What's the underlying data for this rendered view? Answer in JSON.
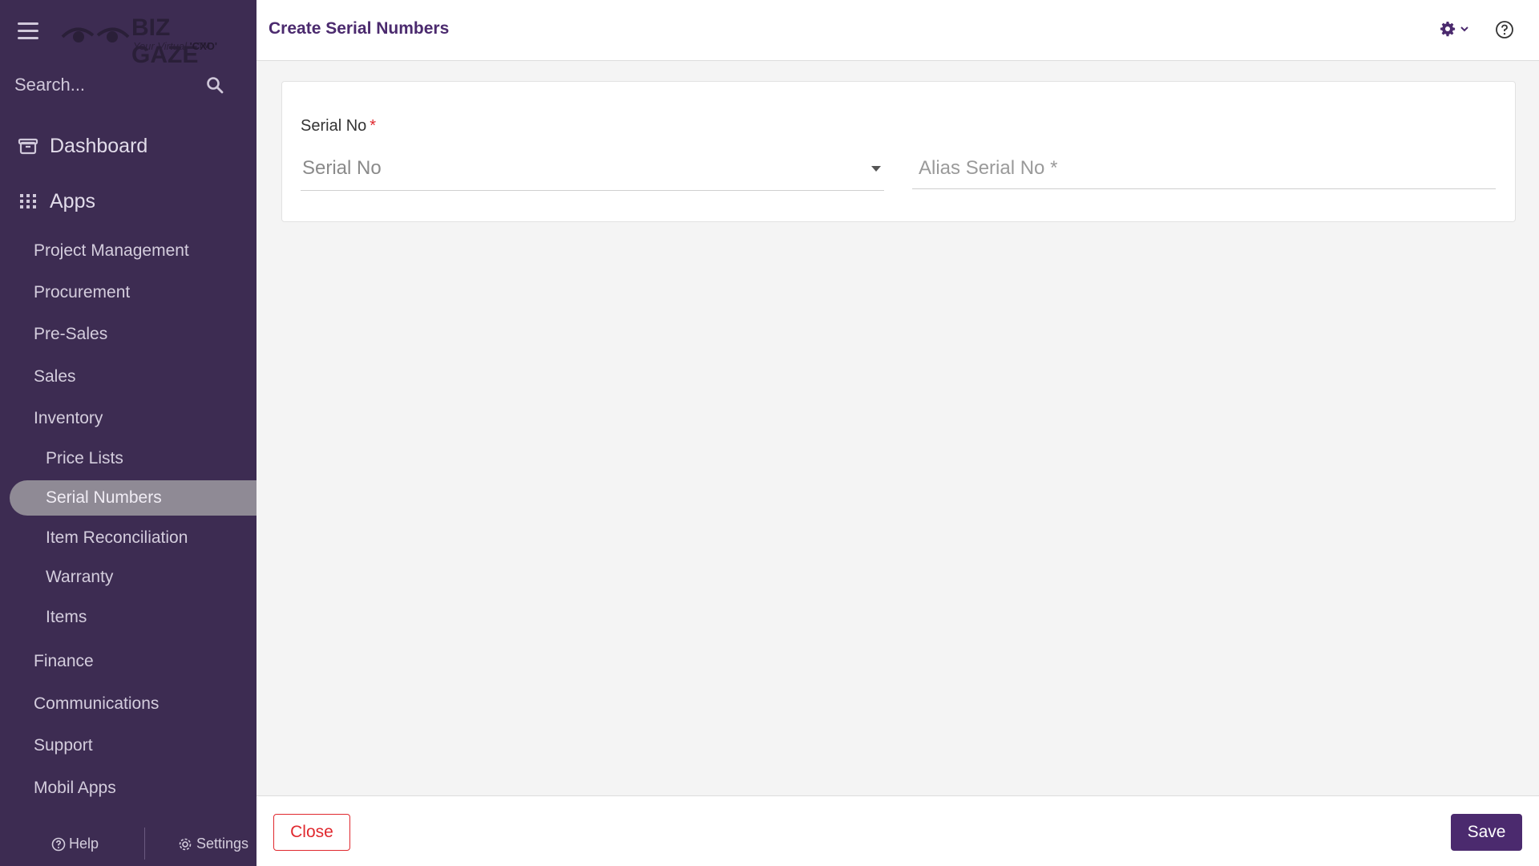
{
  "brand": {
    "name": "BIZ GAZE",
    "trademark": "TM",
    "tagline_prefix": "Your Virtual",
    "tagline_highlight": "'CXO'"
  },
  "sidebar": {
    "search_placeholder": "Search...",
    "dashboard_label": "Dashboard",
    "apps_label": "Apps",
    "items": [
      {
        "label": "Project Management",
        "level": 1
      },
      {
        "label": "Procurement",
        "level": 1
      },
      {
        "label": "Pre-Sales",
        "level": 1
      },
      {
        "label": "Sales",
        "level": 1
      },
      {
        "label": "Inventory",
        "level": 1
      },
      {
        "label": "Price Lists",
        "level": 2
      },
      {
        "label": "Serial Numbers",
        "level": 2,
        "active": true
      },
      {
        "label": "Item Reconciliation",
        "level": 2
      },
      {
        "label": "Warranty",
        "level": 2
      },
      {
        "label": "Items",
        "level": 2
      },
      {
        "label": "Finance",
        "level": 1
      },
      {
        "label": "Communications",
        "level": 1
      },
      {
        "label": "Support",
        "level": 1
      },
      {
        "label": "Mobil Apps",
        "level": 1
      }
    ],
    "footer": {
      "help_label": "Help",
      "settings_label": "Settings"
    }
  },
  "header": {
    "title": "Create Serial Numbers"
  },
  "form": {
    "serial_no": {
      "label": "Serial No",
      "required_mark": "*",
      "placeholder": "Serial No"
    },
    "alias_serial_no": {
      "placeholder": "Alias Serial No *"
    }
  },
  "footer": {
    "close_label": "Close",
    "save_label": "Save"
  },
  "colors": {
    "sidebar_bg": "#3d2c52",
    "accent": "#4b2a6e",
    "danger": "#e0282e",
    "active_item_bg": "#8f8a95"
  }
}
